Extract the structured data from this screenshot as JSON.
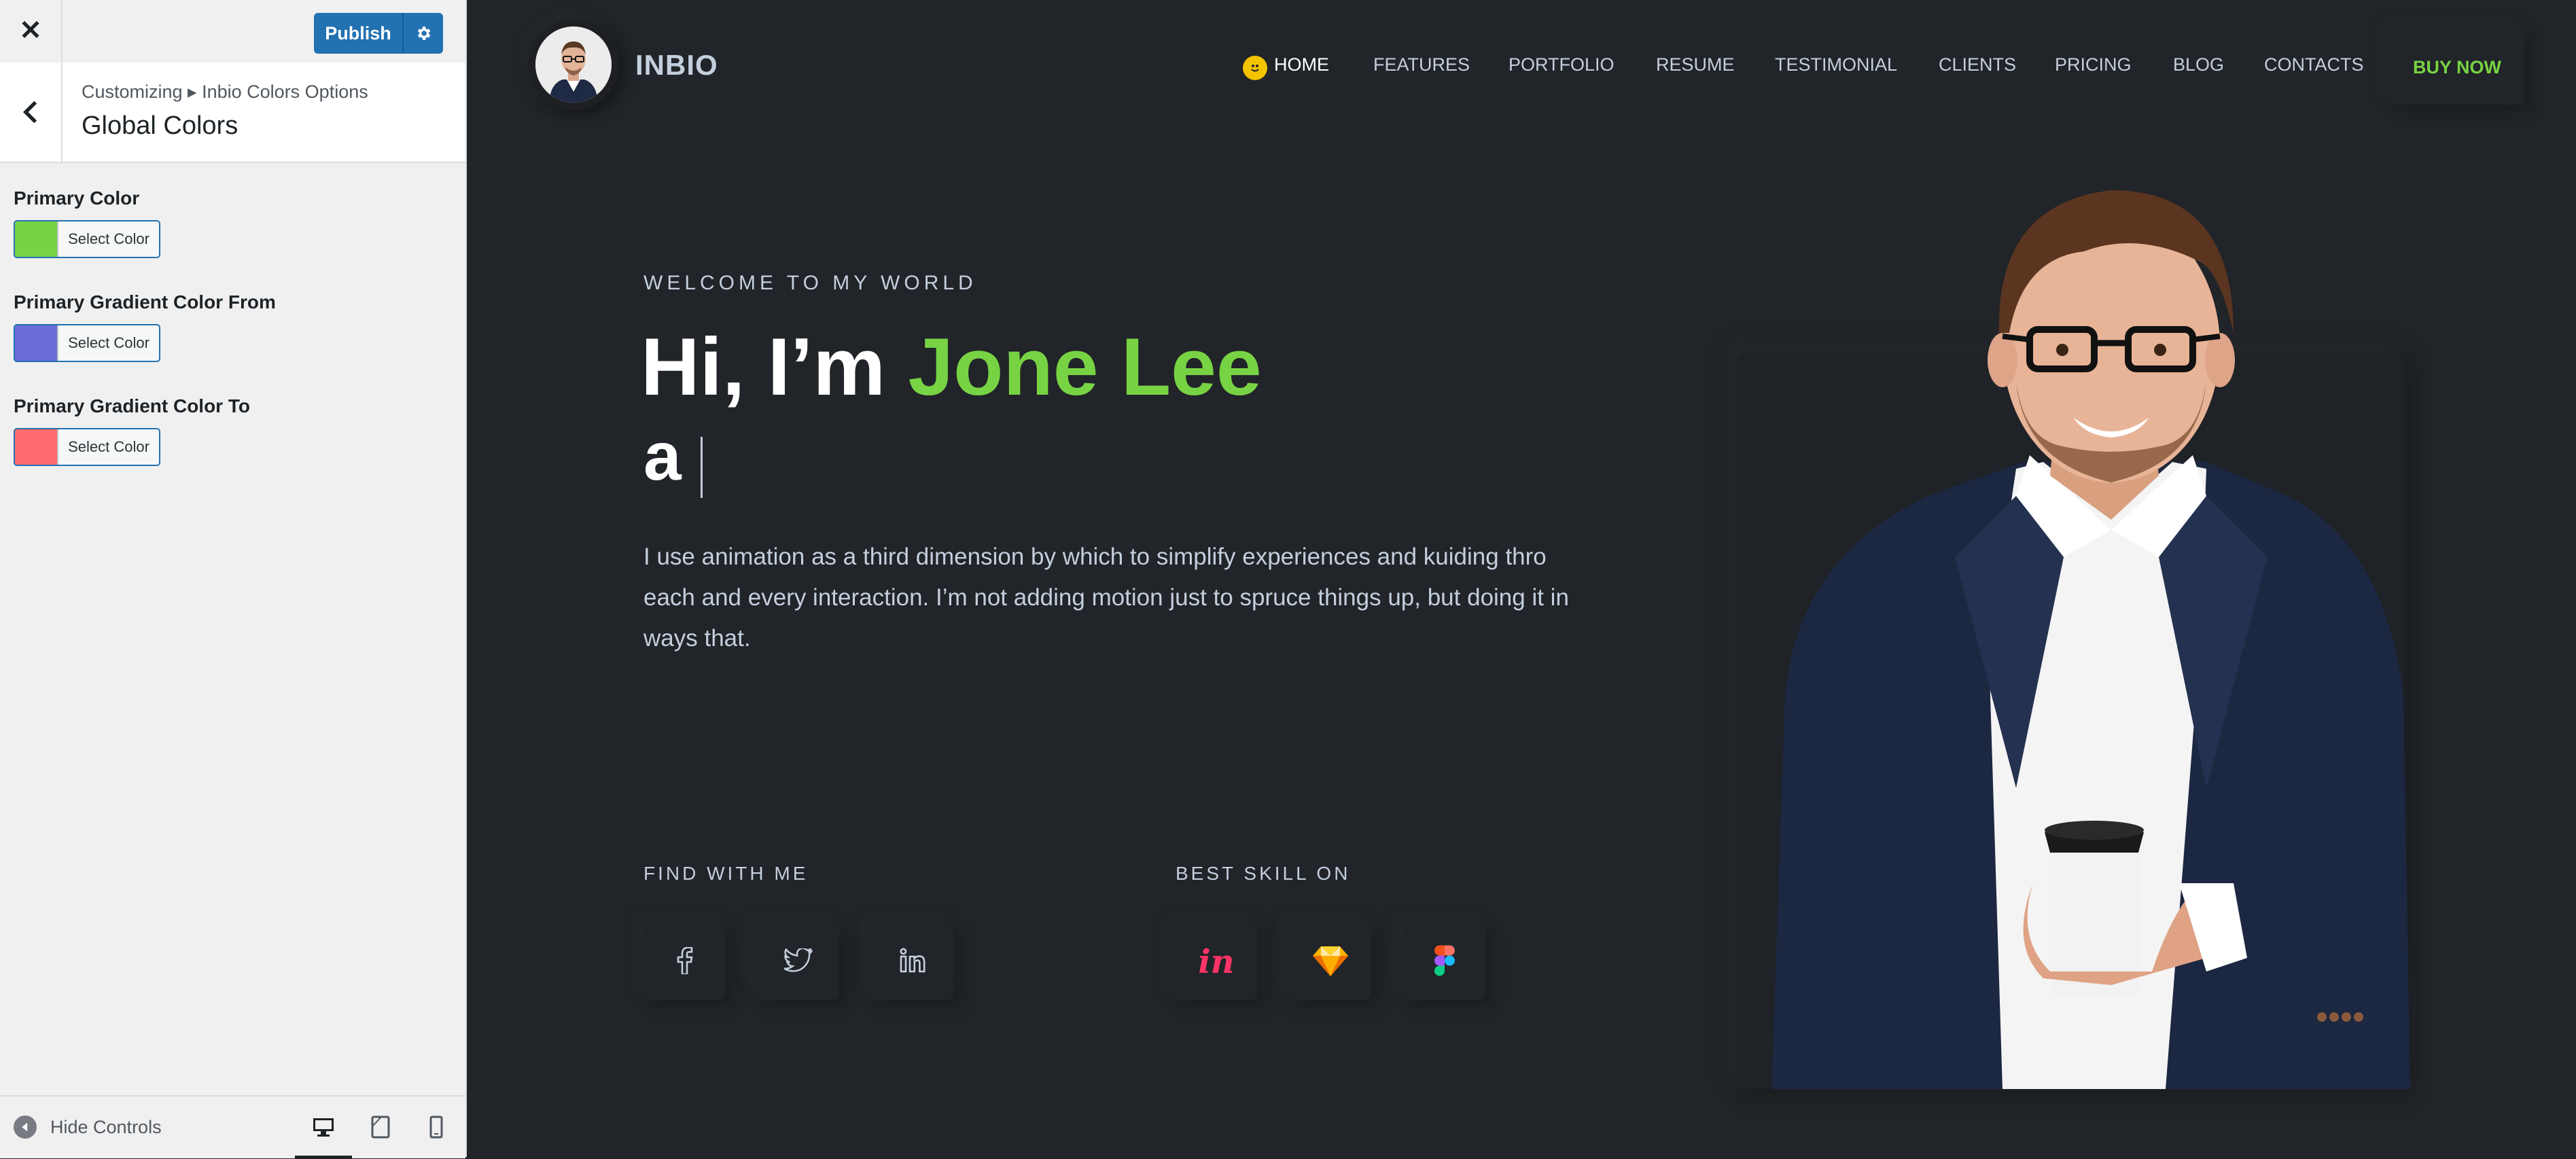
{
  "customizer": {
    "publish_label": "Publish",
    "breadcrumb": "Customizing ▸ Inbio Colors Options",
    "section_title": "Global Colors",
    "controls": [
      {
        "label": "Primary Color",
        "button_label": "Select Color",
        "swatch": "#78d344"
      },
      {
        "label": "Primary Gradient Color From",
        "button_label": "Select Color",
        "swatch": "#6b6bd6"
      },
      {
        "label": "Primary Gradient Color To",
        "button_label": "Select Color",
        "swatch": "#ff6b6e"
      }
    ],
    "hide_controls_label": "Hide Controls"
  },
  "site": {
    "brand": "INBIO",
    "nav": [
      "HOME",
      "FEATURES",
      "PORTFOLIO",
      "RESUME",
      "TESTIMONIAL",
      "CLIENTS",
      "PRICING",
      "BLOG",
      "CONTACTS"
    ],
    "buy_now": "BUY NOW",
    "hero": {
      "welcome": "WELCOME TO MY WORLD",
      "greeting": "Hi, I’m ",
      "name": "Jone Lee",
      "typed": "a",
      "description": "I use animation as a third dimension by which to simplify experiences and kuiding thro each and every interaction. I’m not adding motion just to spruce things up, but doing it in ways that."
    },
    "find_with_me": "FIND WITH ME",
    "best_skill_on": "BEST SKILL ON",
    "social_icons": [
      "facebook-icon",
      "twitter-icon",
      "linkedin-icon"
    ],
    "skill_icons": [
      "invision-icon",
      "sketch-icon",
      "figma-icon"
    ]
  },
  "colors": {
    "accent": "#78d344",
    "background": "#212428",
    "text": "#c4cfde",
    "wp_blue": "#2271b1"
  }
}
